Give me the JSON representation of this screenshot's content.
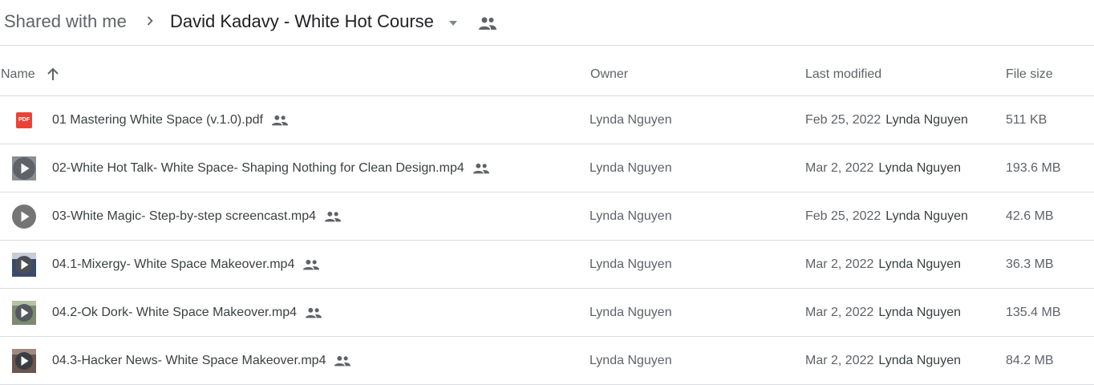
{
  "breadcrumb": {
    "root": "Shared with me",
    "current": "David Kadavy - White Hot Course"
  },
  "columns": {
    "name": "Name",
    "owner": "Owner",
    "modified": "Last modified",
    "size": "File size"
  },
  "icons": {
    "separator": "chevron-right-icon",
    "caret": "caret-down-icon",
    "shared": "people-icon",
    "sort": "arrow-up-icon",
    "pdf": "pdf-icon",
    "video": "video-play-icon"
  },
  "colors": {
    "pdf": "#ea4335",
    "text": "#3c4043",
    "muted": "#5f6368",
    "divider": "#dadce0"
  },
  "files": [
    {
      "name": "01 Mastering White Space (v.1.0).pdf",
      "type": "pdf",
      "pdf_label": "PDF",
      "owner": "Lynda Nguyen",
      "modified_date": "Feb 25, 2022",
      "modified_by": "Lynda Nguyen",
      "size": "511 KB"
    },
    {
      "name": "02-White Hot Talk- White Space- Shaping Nothing for Clean Design.mp4",
      "type": "video",
      "owner": "Lynda Nguyen",
      "modified_date": "Mar 2, 2022",
      "modified_by": "Lynda Nguyen",
      "size": "193.6 MB"
    },
    {
      "name": "03-White Magic- Step-by-step screencast.mp4",
      "type": "video",
      "owner": "Lynda Nguyen",
      "modified_date": "Feb 25, 2022",
      "modified_by": "Lynda Nguyen",
      "size": "42.6 MB"
    },
    {
      "name": "04.1-Mixergy- White Space Makeover.mp4",
      "type": "video",
      "owner": "Lynda Nguyen",
      "modified_date": "Mar 2, 2022",
      "modified_by": "Lynda Nguyen",
      "size": "36.3 MB"
    },
    {
      "name": "04.2-Ok Dork- White Space Makeover.mp4",
      "type": "video",
      "owner": "Lynda Nguyen",
      "modified_date": "Mar 2, 2022",
      "modified_by": "Lynda Nguyen",
      "size": "135.4 MB"
    },
    {
      "name": "04.3-Hacker News- White Space Makeover.mp4",
      "type": "video",
      "owner": "Lynda Nguyen",
      "modified_date": "Mar 2, 2022",
      "modified_by": "Lynda Nguyen",
      "size": "84.2 MB"
    }
  ]
}
